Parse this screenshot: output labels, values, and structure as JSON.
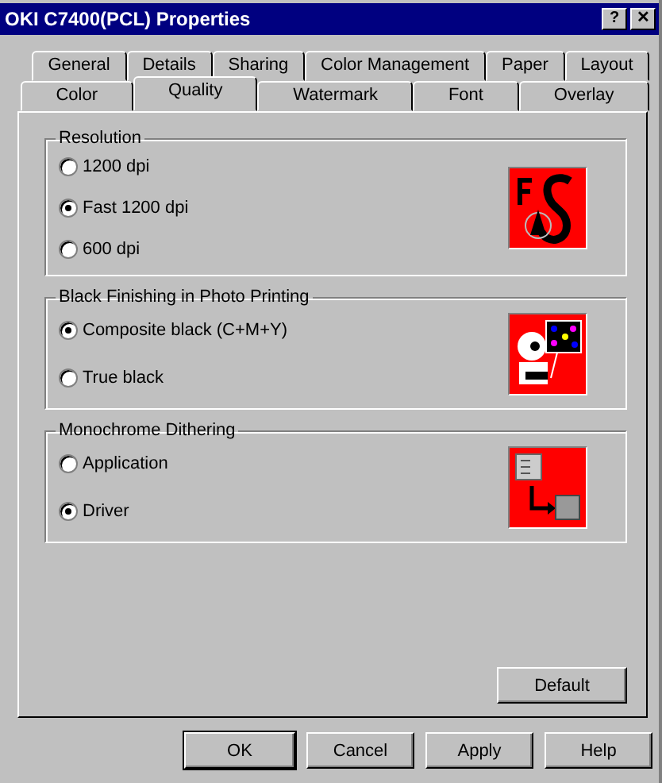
{
  "window": {
    "title": "OKI C7400(PCL) Properties",
    "help_button": "?",
    "close_button": "✕"
  },
  "tabs": [
    [
      {
        "label": "General",
        "selected": false
      },
      {
        "label": "Details",
        "selected": false
      },
      {
        "label": "Sharing",
        "selected": false
      },
      {
        "label": "Color Management",
        "selected": false
      },
      {
        "label": "Paper",
        "selected": false
      },
      {
        "label": "Layout",
        "selected": false
      }
    ],
    [
      {
        "label": "Color",
        "selected": false
      },
      {
        "label": "Quality",
        "selected": true
      },
      {
        "label": "Watermark",
        "selected": false
      },
      {
        "label": "Font",
        "selected": false
      },
      {
        "label": "Overlay",
        "selected": false
      }
    ]
  ],
  "groups": [
    {
      "title": "Resolution",
      "kind": "font",
      "options": [
        {
          "label": "1200 dpi",
          "selected": false
        },
        {
          "label": "Fast 1200 dpi",
          "selected": true
        },
        {
          "label": "600 dpi",
          "selected": false
        }
      ]
    },
    {
      "title": "Black Finishing in Photo Printing",
      "kind": "photo",
      "options": [
        {
          "label": "Composite black (C+M+Y)",
          "selected": true
        },
        {
          "label": "True black",
          "selected": false
        }
      ]
    },
    {
      "title": "Monochrome Dithering",
      "kind": "dither",
      "options": [
        {
          "label": "Application",
          "selected": false
        },
        {
          "label": "Driver",
          "selected": true
        }
      ]
    }
  ],
  "default_button": "Default",
  "buttons": [
    {
      "label": "OK",
      "default": true
    },
    {
      "label": "Cancel",
      "default": false
    },
    {
      "label": "Apply",
      "default": false
    },
    {
      "label": "Help",
      "default": false
    }
  ]
}
